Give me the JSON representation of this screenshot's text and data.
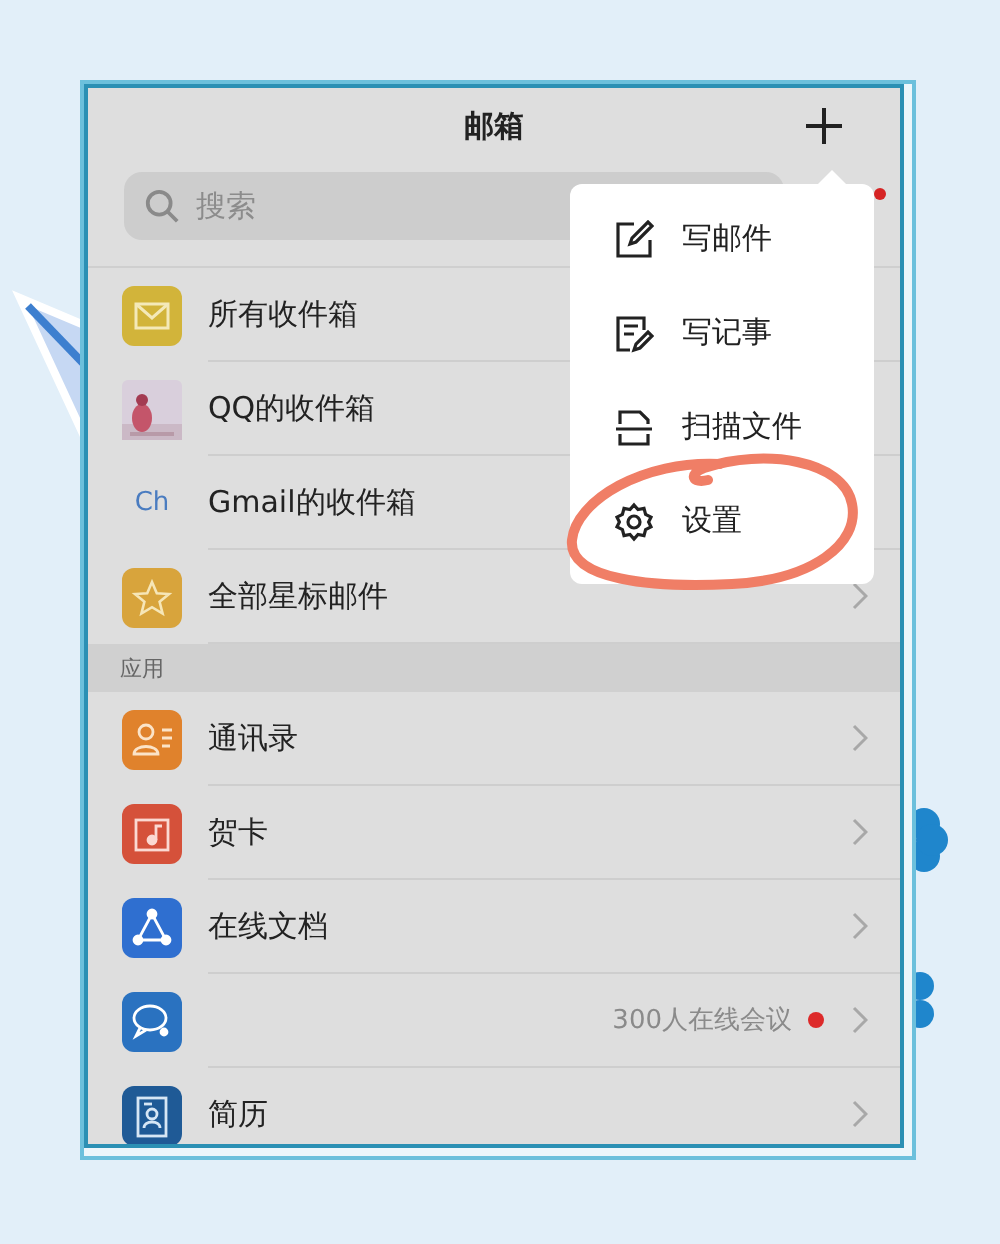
{
  "header": {
    "title": "邮箱",
    "add_badge": true
  },
  "search": {
    "placeholder": "搜索"
  },
  "mailboxes": [
    {
      "label": "所有收件箱",
      "kind": "inbox"
    },
    {
      "label": "QQ的收件箱",
      "kind": "picture"
    },
    {
      "label": "Gmail的收件箱",
      "kind": "text",
      "icon_text": "Ch"
    },
    {
      "label": "全部星标邮件",
      "kind": "star"
    }
  ],
  "apps_section": {
    "title": "应用"
  },
  "apps": [
    {
      "label": "通讯录",
      "kind": "contacts",
      "color": "#e0822c"
    },
    {
      "label": "贺卡",
      "kind": "card",
      "color": "#d5513a"
    },
    {
      "label": "在线文档",
      "kind": "docs",
      "color": "#2f6fd0"
    },
    {
      "kind": "chat",
      "color": "#2a72c0",
      "note": "300人在线会议",
      "badge": true
    },
    {
      "label": "简历",
      "kind": "resume",
      "color": "#1f5a96"
    }
  ],
  "menu": [
    {
      "label": "写邮件",
      "kind": "compose"
    },
    {
      "label": "写记事",
      "kind": "note"
    },
    {
      "label": "扫描文件",
      "kind": "scan"
    },
    {
      "label": "设置",
      "kind": "settings"
    }
  ]
}
